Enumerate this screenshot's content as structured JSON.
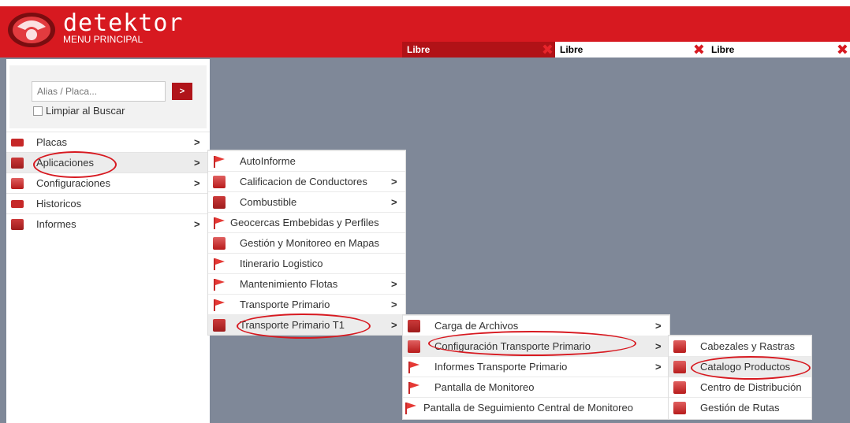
{
  "header": {
    "brand": "detektor",
    "subtitle": "MENU PRINCIPAL"
  },
  "tabs": [
    {
      "label": "Libre"
    },
    {
      "label": "Libre"
    },
    {
      "label": "Libre"
    }
  ],
  "search": {
    "placeholder": "Alias / Placa...",
    "button_label": ">",
    "clear_label": "Limpiar al Buscar"
  },
  "menu": [
    {
      "label": "Placas",
      "arrow": ">",
      "icon": "plates-icon"
    },
    {
      "label": "Aplicaciones",
      "arrow": ">",
      "icon": "cube-icon"
    },
    {
      "label": "Configuraciones",
      "arrow": ">",
      "icon": "settings-icon"
    },
    {
      "label": "Historicos",
      "arrow": "",
      "icon": "history-icon"
    },
    {
      "label": "Informes",
      "arrow": ">",
      "icon": "reports-icon"
    }
  ],
  "aplicaciones": [
    {
      "label": "AutoInforme",
      "arrow": "",
      "icon": "flag-icon"
    },
    {
      "label": "Calificacion de Conductores",
      "arrow": ">",
      "icon": "box-icon"
    },
    {
      "label": "Combustible",
      "arrow": ">",
      "icon": "cube-icon"
    },
    {
      "label": "Geocercas Embebidas y Perfiles",
      "arrow": "",
      "icon": "flag-icon"
    },
    {
      "label": "Gestión y Monitoreo en Mapas",
      "arrow": "",
      "icon": "box-icon"
    },
    {
      "label": "Itinerario Logistico",
      "arrow": "",
      "icon": "flag-icon"
    },
    {
      "label": "Mantenimiento Flotas",
      "arrow": ">",
      "icon": "flag-icon"
    },
    {
      "label": "Transporte Primario",
      "arrow": ">",
      "icon": "flag-icon"
    },
    {
      "label": "Transporte Primario T1",
      "arrow": ">",
      "icon": "cube-icon"
    }
  ],
  "transporte_t1": [
    {
      "label": "Carga de Archivos",
      "arrow": ">",
      "icon": "cube-icon"
    },
    {
      "label": "Configuración Transporte Primario",
      "arrow": ">",
      "icon": "box-icon"
    },
    {
      "label": "Informes Transporte Primario",
      "arrow": ">",
      "icon": "flag-icon"
    },
    {
      "label": "Pantalla de Monitoreo",
      "arrow": "",
      "icon": "flag-icon"
    },
    {
      "label": "Pantalla de Seguimiento Central de Monitoreo",
      "arrow": "",
      "icon": "flag-icon"
    }
  ],
  "configuracion": [
    {
      "label": "Cabezales y Rastras",
      "icon": "box-icon"
    },
    {
      "label": "Catalogo Productos",
      "icon": "box-icon"
    },
    {
      "label": "Centro de Distribución",
      "icon": "box-icon"
    },
    {
      "label": "Gestión de Rutas",
      "icon": "box-icon"
    }
  ],
  "colors": {
    "brand_red": "#d71920",
    "background": "#7f8898",
    "dark_tab": "#b11217"
  }
}
